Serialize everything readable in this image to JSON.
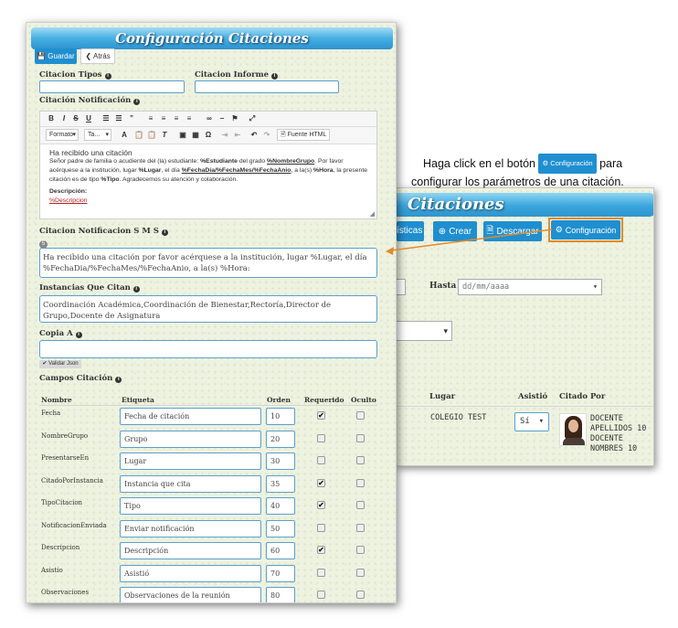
{
  "annotation": {
    "line1_before": "Haga click en el botón",
    "chip": "Configuración",
    "line1_after": "para",
    "line2": "configurar los parámetros de una citación."
  },
  "back_window": {
    "title": "Citaciones",
    "buttons": [
      "ísticas",
      "Crear",
      "Descargar",
      "Configuración"
    ],
    "hasta_label": "Hasta",
    "date_placeholder": "dd/mm/aaaa",
    "columns": [
      "Lugar",
      "Asistió",
      "Citado Por"
    ],
    "row": {
      "lugar": "COLEGIO TEST",
      "asistio": "Sí",
      "citado_por": [
        "DOCENTE",
        "APELLIDOS 10",
        "DOCENTE",
        "NOMBRES 10"
      ]
    },
    "highlight_color": "#e38b2c"
  },
  "front_window": {
    "title": "Configuración Citaciones",
    "save_label": "Guardar",
    "back_label": "Atrás",
    "tipos_label": "Citacion Tipos",
    "informe_label": "Citacion Informe",
    "notificacion_label": "Citación Notificación",
    "editor": {
      "formato": "Formato",
      "font": "Ta...",
      "source": "Fuente HTML",
      "heading": "Ha recibido una citación",
      "p1": "Señor padre de familia o acudiente del (la) estudiante:",
      "v_estudiante": "%Estudiante",
      "p2": "del grado",
      "v_grupo": "%NombreGrupo",
      "p3": ". Por favor",
      "p4": "acérquese a la institución, lugar",
      "v_lugar": "%Lugar",
      "p5": ", el día",
      "v_fecha": "%FechaDia/%FechaMes/%FechaAnio",
      "p6": ", a la(s)",
      "v_hora": "%Hora",
      "p7": ", la",
      "p8": "presente citación es de tipo",
      "v_tipo": "%Tipo",
      "p9": ". Agradecemos su atención y colaboración.",
      "desc_label": "Descripción:",
      "desc_var": "%Descripcion"
    },
    "sms_label": "Citacion Notificacion S M S",
    "sms_count": "5",
    "sms_text": "Ha recibido una citación por favor acérquese a la institución, lugar %Lugar, el día %FechaDia/%FechaMes/%FechaAnio, a la(s) %Hora:",
    "instancias_label": "Instancias Que Citan",
    "instancias_text": "Coordinación Académica,Coordinación de Bienestar,Rectoría,Director de Grupo,Docente de Asignatura",
    "copia_label": "Copia A",
    "validar_label": "Validar Json",
    "campos_label": "Campos Citación",
    "table_headers": [
      "Nombre",
      "Etiqueta",
      "Orden",
      "Requerido",
      "Oculto"
    ],
    "rows": [
      {
        "nombre": "Fecha",
        "etiqueta": "Fecha de citación",
        "orden": "10",
        "requerido": true,
        "oculto": false
      },
      {
        "nombre": "NombreGrupo",
        "etiqueta": "Grupo",
        "orden": "20",
        "requerido": false,
        "oculto": false
      },
      {
        "nombre": "PresentarseEn",
        "etiqueta": "Lugar",
        "orden": "30",
        "requerido": false,
        "oculto": false
      },
      {
        "nombre": "CitadoPorInstancia",
        "etiqueta": "Instancia que cita",
        "orden": "35",
        "requerido": true,
        "oculto": false
      },
      {
        "nombre": "TipoCitacion",
        "etiqueta": "Tipo",
        "orden": "40",
        "requerido": true,
        "oculto": false
      },
      {
        "nombre": "NotificacionEnviada",
        "etiqueta": "Enviar notificación",
        "orden": "50",
        "requerido": false,
        "oculto": false
      },
      {
        "nombre": "Descripcion",
        "etiqueta": "Descripción",
        "orden": "60",
        "requerido": true,
        "oculto": false
      },
      {
        "nombre": "Asistio",
        "etiqueta": "Asistió",
        "orden": "70",
        "requerido": false,
        "oculto": false
      },
      {
        "nombre": "Observaciones",
        "etiqueta": "Observaciones de la reunión",
        "orden": "80",
        "requerido": false,
        "oculto": false
      }
    ]
  }
}
